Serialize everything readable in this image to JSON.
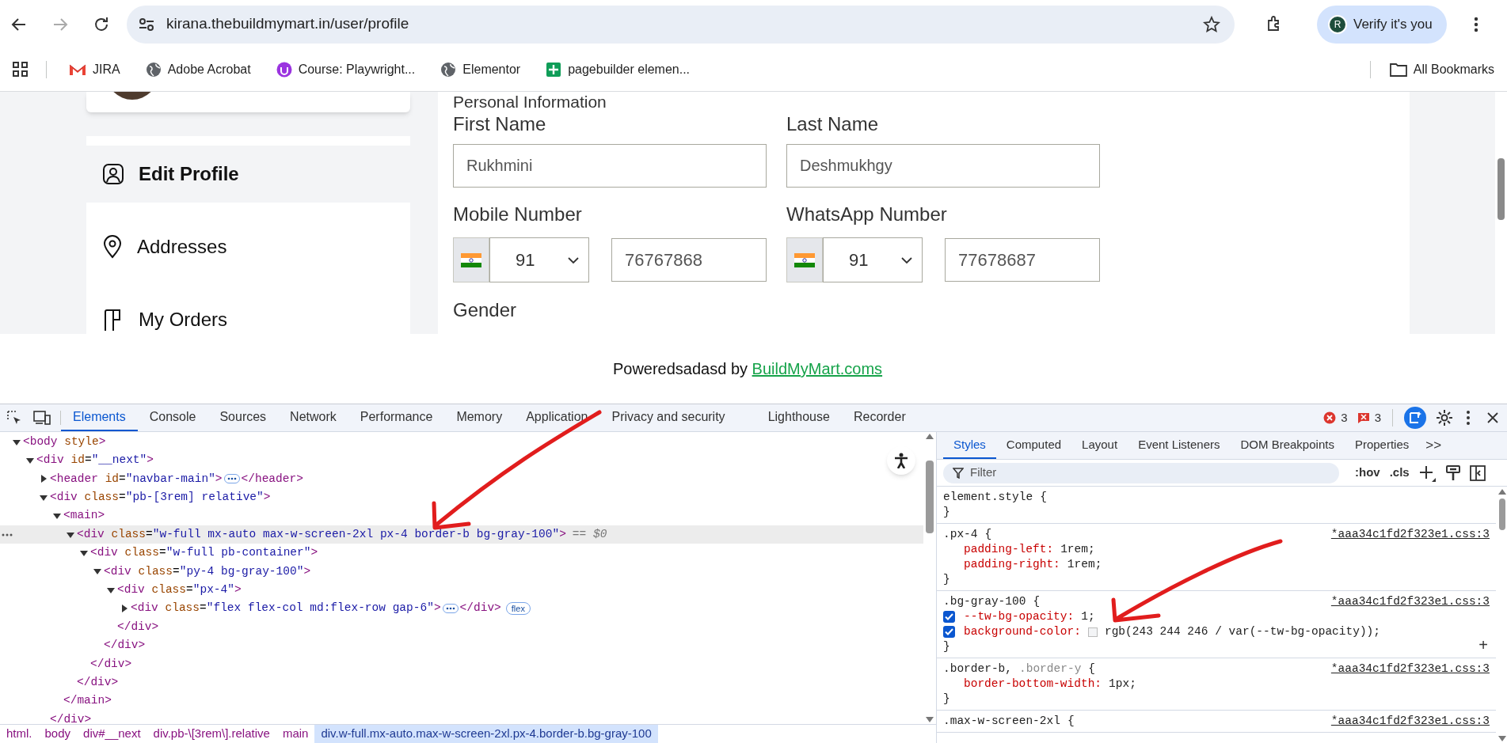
{
  "browser": {
    "url": "kirana.thebuildmymart.in/user/profile",
    "profile": {
      "initial": "R",
      "label": "Verify it's you"
    },
    "bookmarks": [
      {
        "kind": "jira",
        "label": "JIRA"
      },
      {
        "kind": "globe",
        "label": "Adobe Acrobat"
      },
      {
        "kind": "course",
        "label": "Course: Playwright..."
      },
      {
        "kind": "globe",
        "label": "Elementor"
      },
      {
        "kind": "sheet",
        "label": "pagebuilder elemen..."
      }
    ],
    "all_bookmarks": "All Bookmarks"
  },
  "page": {
    "sidebar": {
      "items": [
        {
          "kind": "profile",
          "label": "Edit Profile",
          "selected": true
        },
        {
          "kind": "pin",
          "label": "Addresses",
          "selected": false
        },
        {
          "kind": "orders",
          "label": "My Orders",
          "selected": false
        }
      ]
    },
    "form": {
      "heading": "Personal Information",
      "name_fields": [
        {
          "label": "First Name",
          "value": "Rukhmini"
        },
        {
          "label": "Last Name",
          "value": "Deshmukhgy"
        }
      ],
      "phone_fields": [
        {
          "label": "Mobile Number",
          "code": "91",
          "value": "76767868"
        },
        {
          "label": "WhatsApp Number",
          "code": "91",
          "value": "77678687"
        }
      ],
      "gender_label": "Gender"
    },
    "footer": {
      "text": "Poweredsadasd by",
      "link": "BuildMyMart.coms"
    }
  },
  "devtools": {
    "tabs": [
      {
        "label": "Elements",
        "selected": true
      },
      {
        "label": "Console",
        "selected": false
      },
      {
        "label": "Sources",
        "selected": false
      },
      {
        "label": "Network",
        "selected": false
      },
      {
        "label": "Performance",
        "selected": false
      },
      {
        "label": "Memory",
        "selected": false
      },
      {
        "label": "Application",
        "selected": false
      },
      {
        "label": "Privacy and security",
        "selected": false
      },
      {
        "label": "Lighthouse",
        "selected": false
      },
      {
        "label": "Recorder",
        "selected": false
      }
    ],
    "errors": "3",
    "issues": "3",
    "tree": [
      {
        "open": "<body style>",
        "expanded": true,
        "selected": false,
        "children": [
          {
            "open": "<div id=\"__next\">",
            "expanded": true,
            "selected": false,
            "children": [
              {
                "open": "<header id=\"navbar-main\">",
                "close": "</header>",
                "expanded": false,
                "selected": false
              },
              {
                "open": "<div class=\"pb-[3rem] relative\">",
                "close": "</div>",
                "expanded": true,
                "selected": false,
                "children": [
                  {
                    "open": "<main>",
                    "close": "</main>",
                    "expanded": true,
                    "selected": false,
                    "children": [
                      {
                        "open": "<div class=\"w-full mx-auto max-w-screen-2xl px-4 border-b bg-gray-100\">",
                        "suffix": "== $0",
                        "close": "</div>",
                        "expanded": true,
                        "selected": true,
                        "children": [
                          {
                            "open": "<div class=\"w-full pb-container\">",
                            "close": "</div>",
                            "expanded": true,
                            "selected": false,
                            "children": [
                              {
                                "open": "<div class=\"py-4 bg-gray-100\">",
                                "close": "</div>",
                                "expanded": true,
                                "selected": false,
                                "children": [
                                  {
                                    "open": "<div class=\"px-4\">",
                                    "close": "</div>",
                                    "expanded": true,
                                    "selected": false,
                                    "children": [
                                      {
                                        "open": "<div class=\"flex flex-col md:flex-row gap-6\">",
                                        "close": "</div>",
                                        "badge": "flex",
                                        "expanded": false,
                                        "selected": false
                                      }
                                    ]
                                  }
                                ]
                              }
                            ]
                          }
                        ]
                      }
                    ]
                  }
                ]
              }
            ]
          }
        ]
      }
    ],
    "breadcrumbs": [
      {
        "label": "html.",
        "selected": false
      },
      {
        "label": "body",
        "selected": false
      },
      {
        "label": "div#__next",
        "selected": false
      },
      {
        "label": "div.pb-\\[3rem\\].relative",
        "selected": false
      },
      {
        "label": "main",
        "selected": false
      },
      {
        "label": "div.w-full.mx-auto.max-w-screen-2xl.px-4.border-b.bg-gray-100",
        "selected": true
      }
    ],
    "side_tabs": [
      {
        "label": "Styles",
        "selected": true
      },
      {
        "label": "Computed",
        "selected": false
      },
      {
        "label": "Layout",
        "selected": false
      },
      {
        "label": "Event Listeners",
        "selected": false
      },
      {
        "label": "DOM Breakpoints",
        "selected": false
      },
      {
        "label": "Properties",
        "selected": false
      }
    ],
    "more_tabs": ">>",
    "filter": {
      "placeholder": "Filter"
    },
    "hov": ":hov",
    "cls": ".cls",
    "rules": [
      {
        "selectors": [
          {
            "text": "element.style",
            "matched": true
          }
        ],
        "open": "{",
        "close": "}"
      },
      {
        "selectors": [
          {
            "text": ".px-4",
            "matched": true
          }
        ],
        "open": "{",
        "close": "}",
        "source": "*aaa34c1fd2f323e1.css:3",
        "declarations": [
          {
            "name": "padding-left:",
            "value": "1rem;"
          },
          {
            "name": "padding-right:",
            "value": "1rem;"
          }
        ]
      },
      {
        "selectors": [
          {
            "text": ".bg-gray-100",
            "matched": true
          }
        ],
        "open": "{",
        "close": "}",
        "source": "*aaa34c1fd2f323e1.css:3",
        "add": "+",
        "declarations": [
          {
            "name": "--tw-bg-opacity:",
            "value": "1;",
            "checked": true
          },
          {
            "name": "background-color:",
            "value": "rgb(243 244 246 / var(--tw-bg-opacity));",
            "checked": true
          }
        ]
      },
      {
        "selectors": [
          {
            "text": ".border-b,",
            "matched": true
          },
          {
            "text": ".border-y",
            "matched": false
          }
        ],
        "open": "{",
        "close": "}",
        "source": "*aaa34c1fd2f323e1.css:3",
        "declarations": [
          {
            "name": "border-bottom-width:",
            "value": "1px;"
          }
        ]
      },
      {
        "selectors": [
          {
            "text": ".max-w-screen-2xl",
            "matched": true
          }
        ],
        "open": "{",
        "source": "*aaa34c1fd2f323e1.css:3"
      }
    ]
  }
}
